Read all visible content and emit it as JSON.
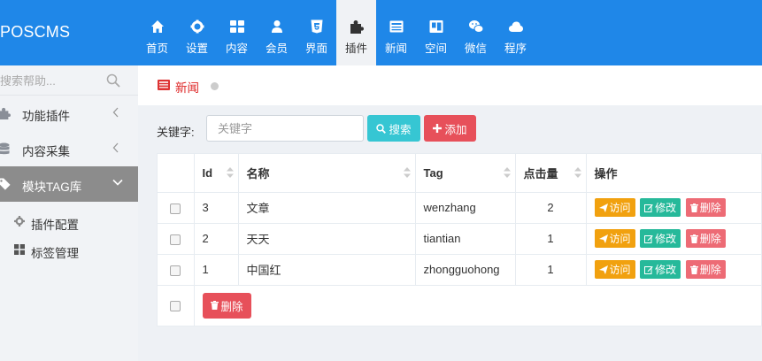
{
  "brand": {
    "logo": "POSCMS"
  },
  "nav": [
    {
      "label": "首页",
      "icon": "home-icon"
    },
    {
      "label": "设置",
      "icon": "gear-icon"
    },
    {
      "label": "内容",
      "icon": "grid-icon"
    },
    {
      "label": "会员",
      "icon": "user-icon"
    },
    {
      "label": "界面",
      "icon": "html5-icon"
    },
    {
      "label": "插件",
      "icon": "puzzle-icon",
      "active": true
    },
    {
      "label": "新闻",
      "icon": "newspaper-icon"
    },
    {
      "label": "空间",
      "icon": "window-icon"
    },
    {
      "label": "微信",
      "icon": "wechat-icon"
    },
    {
      "label": "程序",
      "icon": "cloud-icon"
    }
  ],
  "sidebar": {
    "search_placeholder": "搜索帮助...",
    "menu": [
      {
        "label": "功能插件",
        "icon": "puzzle-icon",
        "state": "collapsed"
      },
      {
        "label": "内容采集",
        "icon": "database-icon",
        "state": "collapsed"
      },
      {
        "label": "模块TAG库",
        "icon": "tag-icon",
        "state": "expanded"
      }
    ],
    "submenu": [
      {
        "label": "插件配置",
        "icon": "gear-icon"
      },
      {
        "label": "标签管理",
        "icon": "grid-icon"
      }
    ]
  },
  "page": {
    "title": "新闻"
  },
  "filter": {
    "label": "关键字:",
    "placeholder": "关键字",
    "search_label": "搜索",
    "add_label": "添加"
  },
  "table": {
    "headers": {
      "id": "Id",
      "name": "名称",
      "tag": "Tag",
      "hits": "点击量",
      "actions": "操作"
    },
    "rows": [
      {
        "id": "3",
        "name": "文章",
        "tag": "wenzhang",
        "hits": "2"
      },
      {
        "id": "2",
        "name": "天天",
        "tag": "tiantian",
        "hits": "1"
      },
      {
        "id": "1",
        "name": "中国红",
        "tag": "zhongguohong",
        "hits": "1"
      }
    ],
    "actions": {
      "visit": "访问",
      "edit": "修改",
      "delete": "删除"
    },
    "bulk_delete_label": "删除"
  },
  "colors": {
    "topbar": "#1f87e8",
    "search_button": "#36c6d3",
    "add_button": "#e7505a",
    "visit_button": "#f1a10f",
    "edit_button": "#26b99a",
    "delete_button": "#ed6b75"
  }
}
